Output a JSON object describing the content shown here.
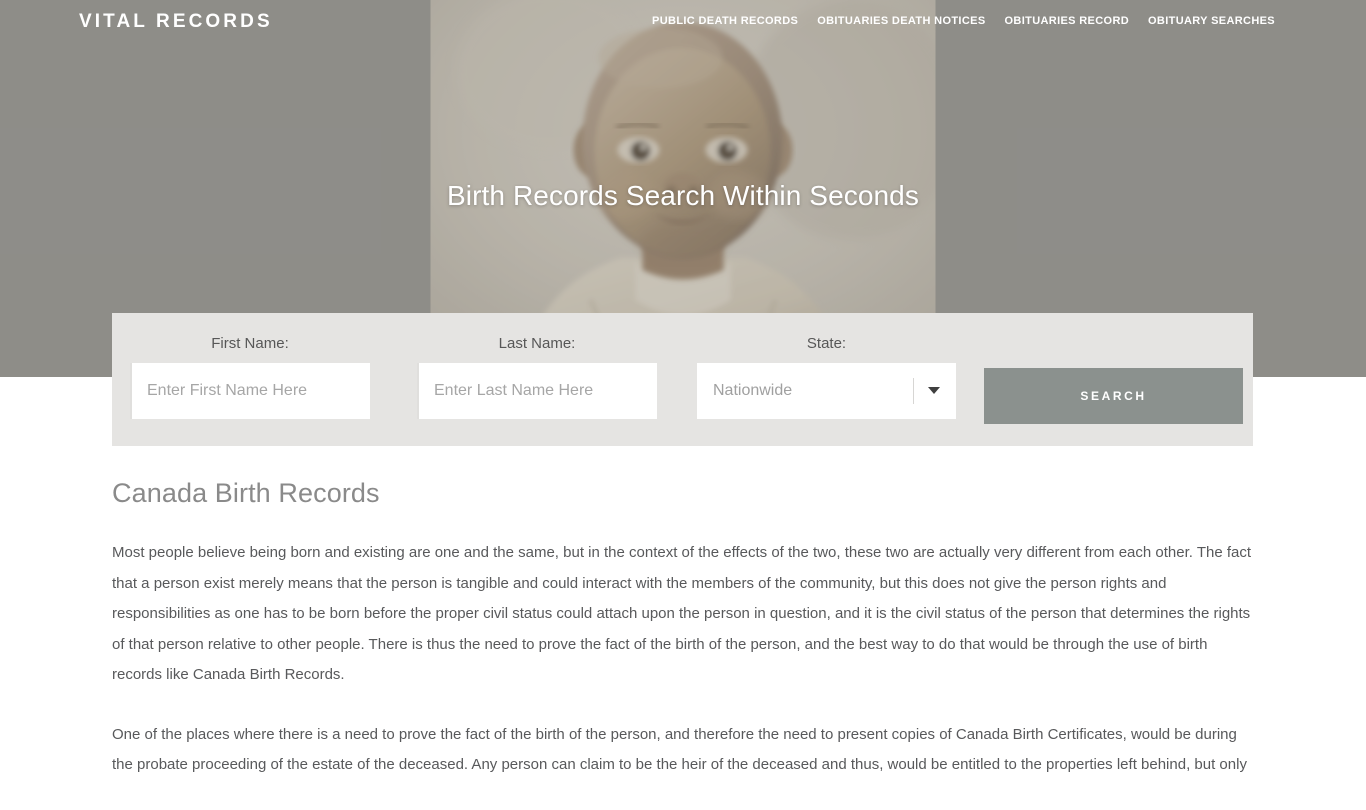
{
  "header": {
    "brand": "VITAL RECORDS",
    "nav": [
      {
        "label": "PUBLIC DEATH RECORDS"
      },
      {
        "label": "OBITUARIES DEATH NOTICES"
      },
      {
        "label": "OBITUARIES RECORD"
      },
      {
        "label": "OBITUARY SEARCHES"
      }
    ]
  },
  "hero": {
    "title": "Birth Records Search Within Seconds",
    "image_alt": "vintage sepia portrait of a baby",
    "background_color": "#8e8d89"
  },
  "search_form": {
    "first_name": {
      "label": "First Name:",
      "placeholder": "Enter First Name Here",
      "value": ""
    },
    "last_name": {
      "label": "Last Name:",
      "placeholder": "Enter Last Name Here",
      "value": ""
    },
    "state": {
      "label": "State:",
      "selected": "Nationwide",
      "icon": "chevron-down-icon"
    },
    "submit_label": "SEARCH",
    "panel_color": "#e5e4e2",
    "button_color": "#8b918e"
  },
  "article": {
    "title": "Canada Birth Records",
    "paragraphs": [
      "Most people believe being born and existing are one and the same, but in the context of the effects of the two, these two are actually very different from each other. The fact that a person exist merely means that the person is tangible and could interact with the members of the community, but this does not give the person rights and responsibilities as one has to be born before the proper civil status could attach upon the person in question, and it is the civil status of the person that determines the rights of that person relative to other people. There is thus the need to prove the fact of the birth of the person, and the best way to do that would be through the use of birth records like Canada Birth Records.",
      "One of the places where there is a need to prove the fact of the birth of the person, and therefore the need to present copies of Canada Birth Certificates, would be during the probate proceeding of the estate of the deceased. Any person can claim to be the heir of the deceased and thus, would be entitled to the properties left behind, but only"
    ]
  }
}
